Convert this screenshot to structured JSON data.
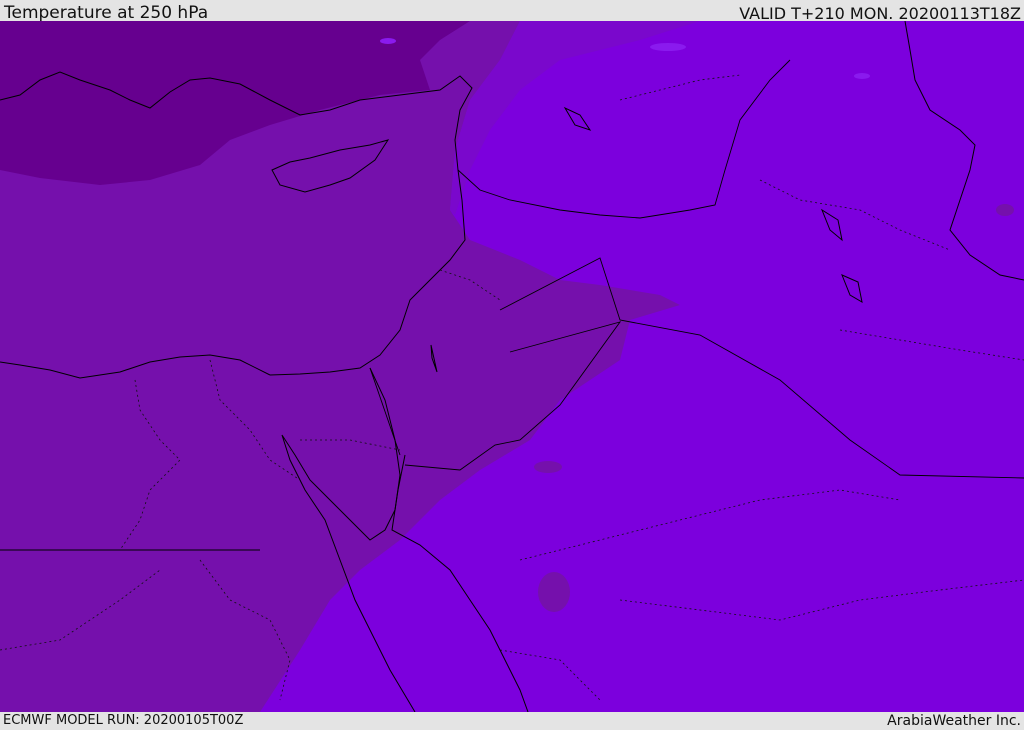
{
  "header": {
    "title": "Temperature at 250 hPa",
    "valid": "VALID T+210 MON. 20200113T18Z"
  },
  "footer": {
    "model_run": "ECMWF MODEL RUN: 20200105T00Z",
    "credit": "ArabiaWeather Inc."
  },
  "map": {
    "region": "Eastern Mediterranean and Middle East",
    "field": "Temperature at 250 hPa",
    "colors": {
      "coldest": "#66008f",
      "cold": "#7510ac",
      "mid": "#7a08cc",
      "warm": "#7c00dd",
      "warmest": "#8a1aee",
      "borders": "#000000"
    }
  }
}
